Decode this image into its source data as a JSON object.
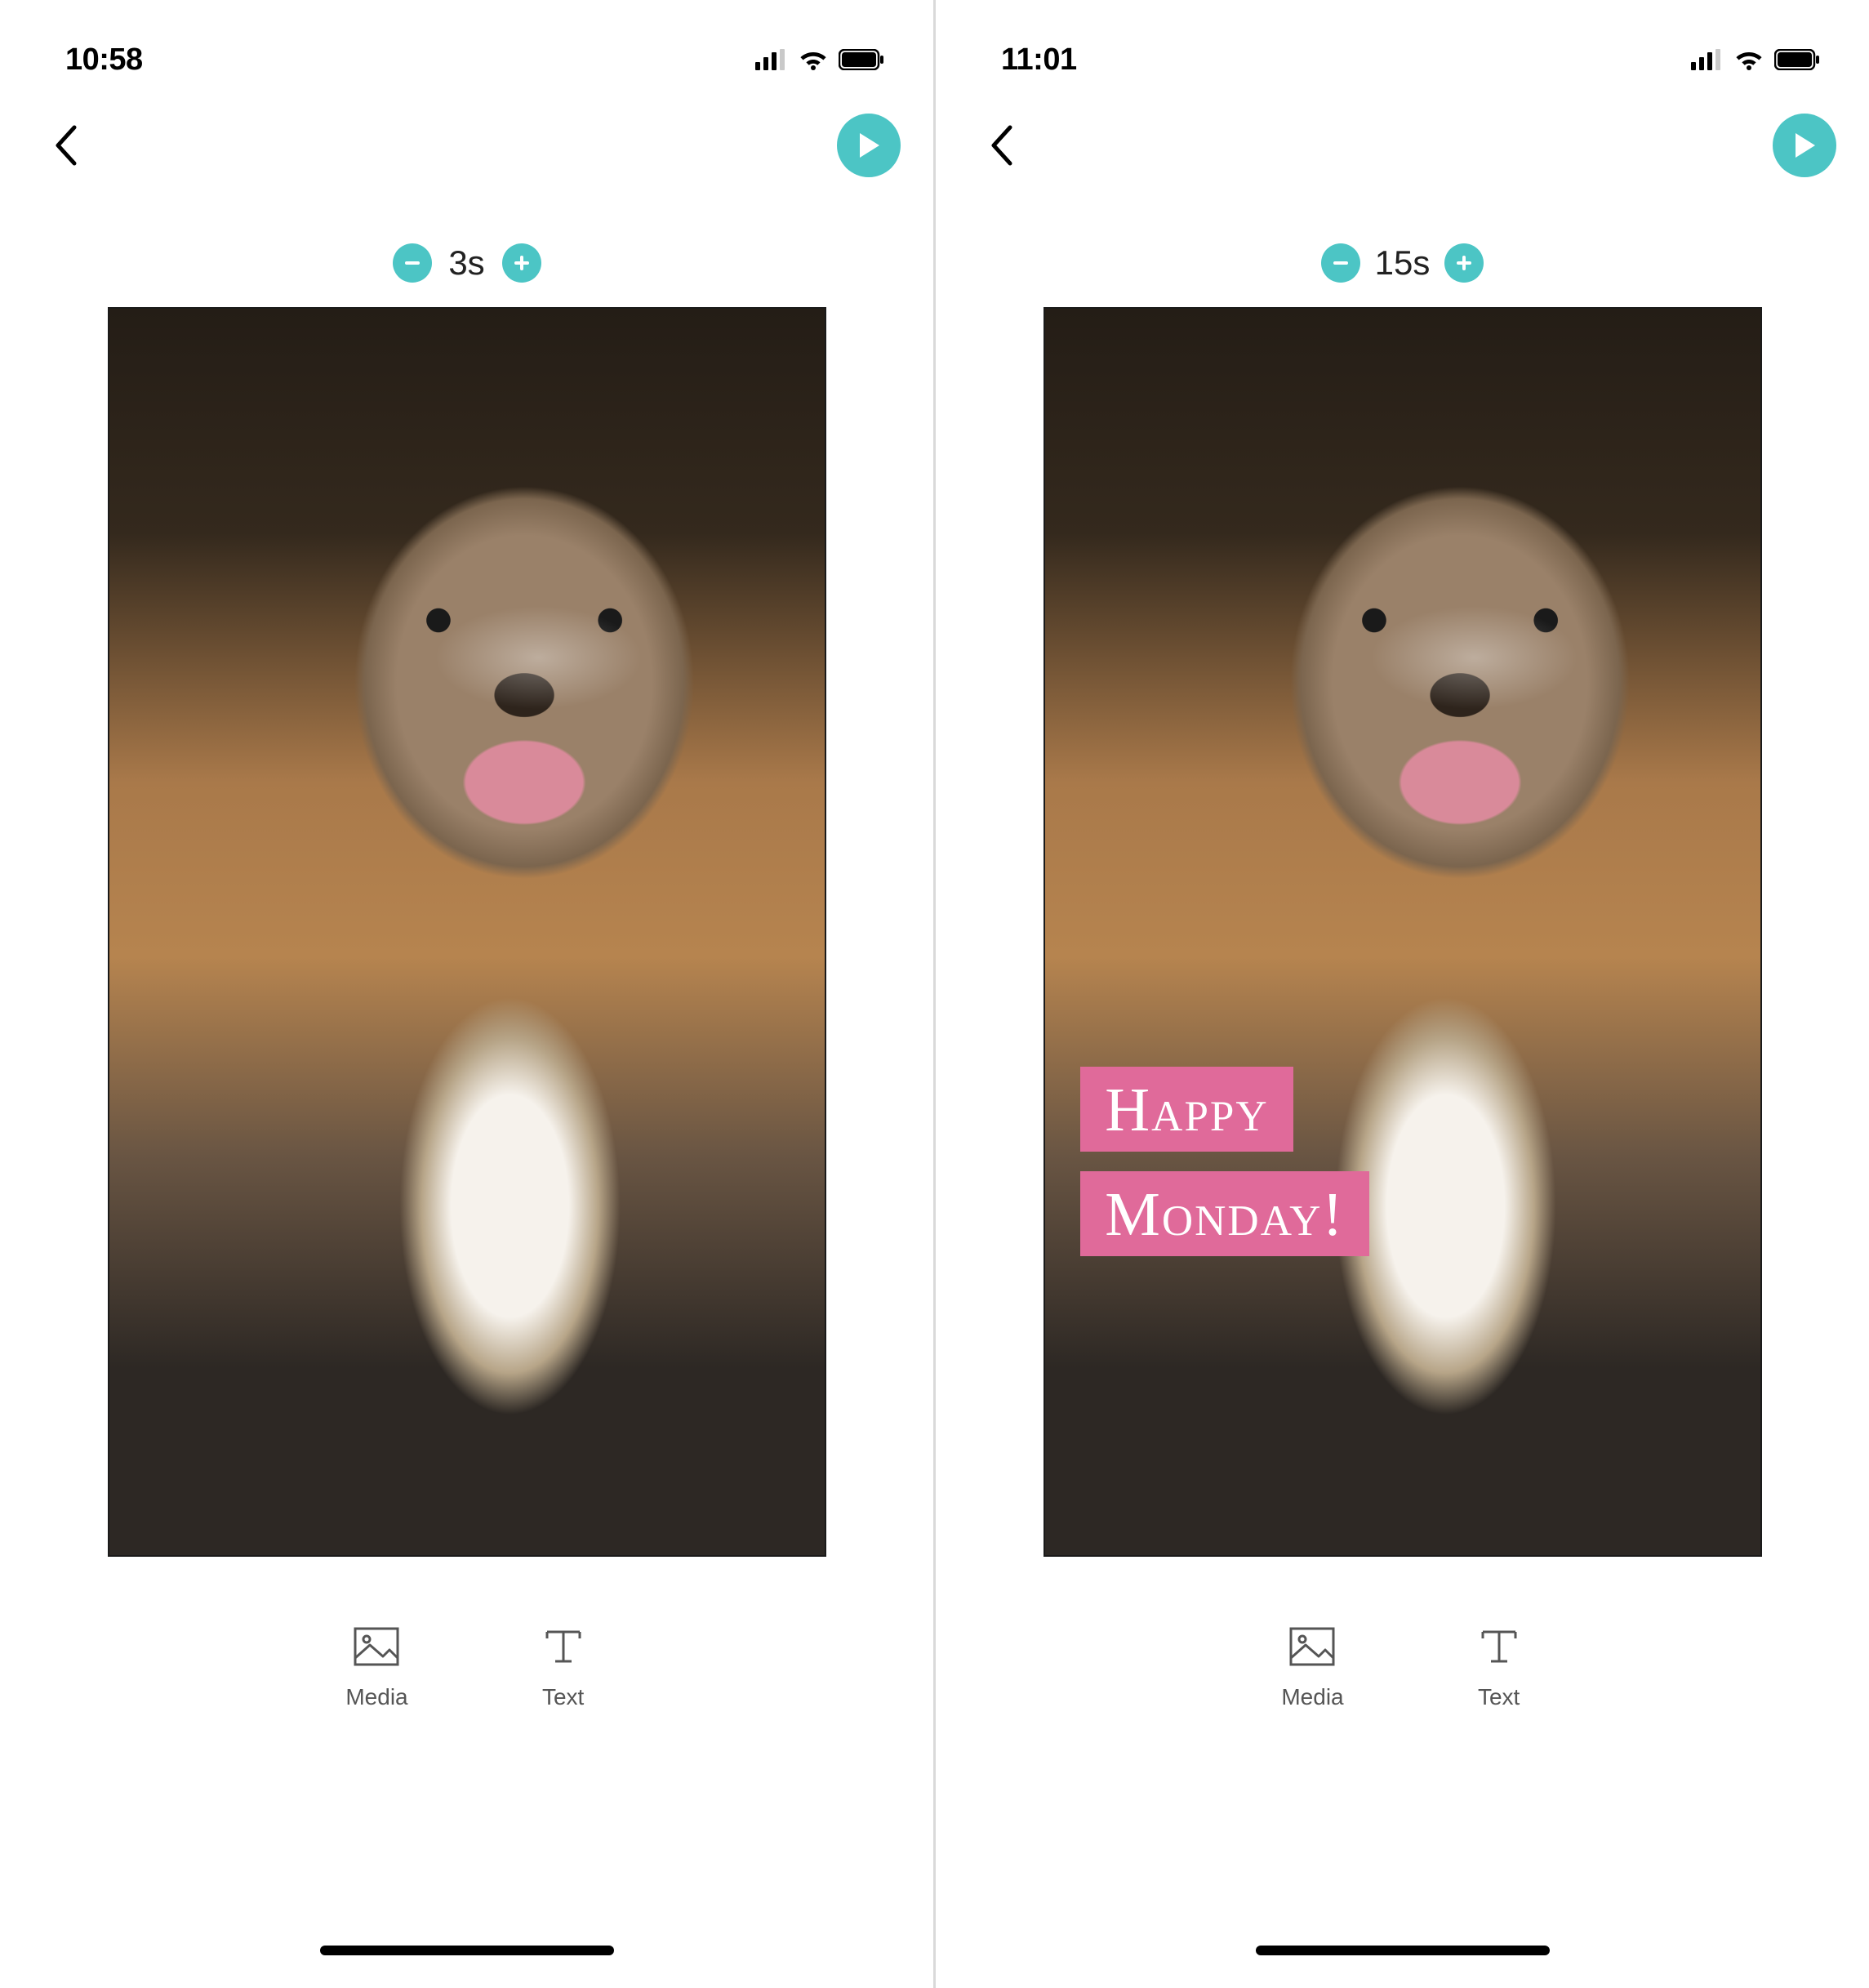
{
  "screens": [
    {
      "status": {
        "time": "10:58"
      },
      "duration": {
        "value": "3s"
      },
      "overlay": {
        "show": false,
        "line1": "",
        "line2": ""
      },
      "toolbar": {
        "media": "Media",
        "text": "Text"
      }
    },
    {
      "status": {
        "time": "11:01"
      },
      "duration": {
        "value": "15s"
      },
      "overlay": {
        "show": true,
        "line1": "Happy",
        "line2": "Monday!"
      },
      "toolbar": {
        "media": "Media",
        "text": "Text"
      }
    }
  ],
  "icons": {
    "minus": "−",
    "plus": "+"
  },
  "colors": {
    "accent": "#4cc5c5",
    "overlay_bg": "#e06a9a"
  }
}
